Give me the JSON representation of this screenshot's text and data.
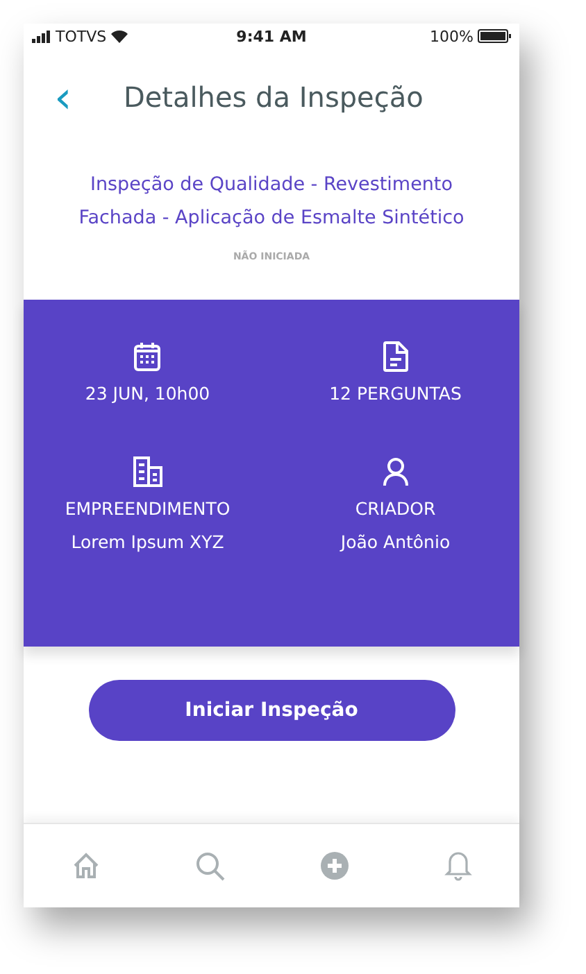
{
  "status_bar": {
    "carrier": "TOTVS",
    "time": "9:41 AM",
    "battery": "100%"
  },
  "header": {
    "back": "‹",
    "title": "Detalhes da Inspeção"
  },
  "inspection": {
    "title_lines": [
      "Inspeção de Qualidade - Revestimento",
      "Fachada - Aplicação de Esmalte Sintético"
    ],
    "status": "NÃO INICIADA"
  },
  "details": [
    {
      "kind": "date",
      "label": "23 JUN, 10h00"
    },
    {
      "kind": "questions",
      "label": "12 PERGUNTAS"
    },
    {
      "kind": "building",
      "label": "EMPREENDIMENTO",
      "value": "Lorem Ipsum XYZ"
    },
    {
      "kind": "person",
      "label": "CRIADOR",
      "value": "João Antônio"
    }
  ],
  "action_button": "Iniciar Inspeção"
}
